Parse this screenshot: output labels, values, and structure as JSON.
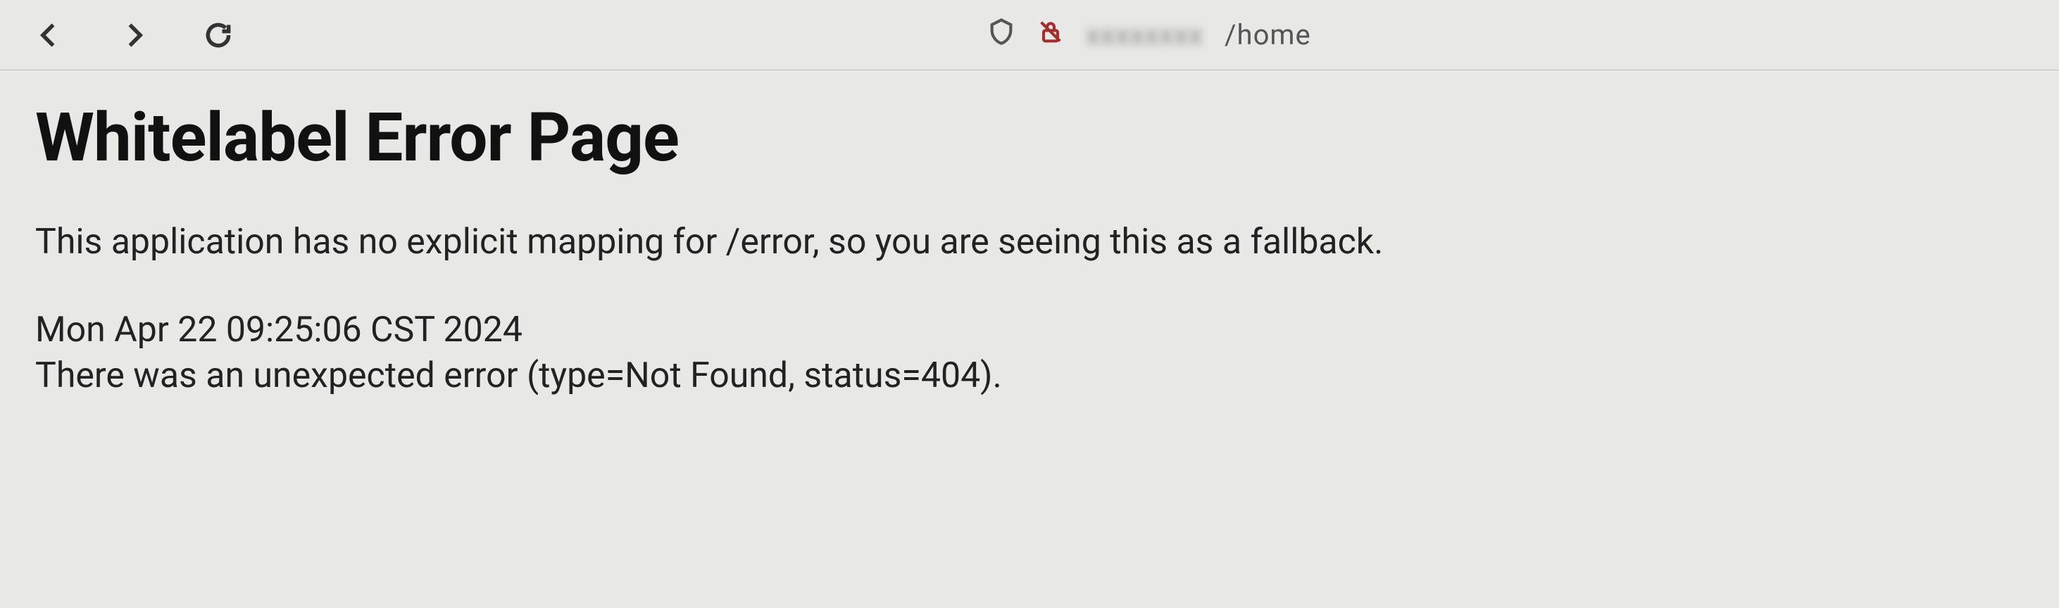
{
  "toolbar": {
    "url_obscured": "xxxxxxxx",
    "url_path": "/home"
  },
  "page": {
    "title": "Whitelabel Error Page",
    "description": "This application has no explicit mapping for /error, so you are seeing this as a fallback.",
    "timestamp": "Mon Apr 22 09:25:06 CST 2024",
    "detail": "There was an unexpected error (type=Not Found, status=404)."
  }
}
